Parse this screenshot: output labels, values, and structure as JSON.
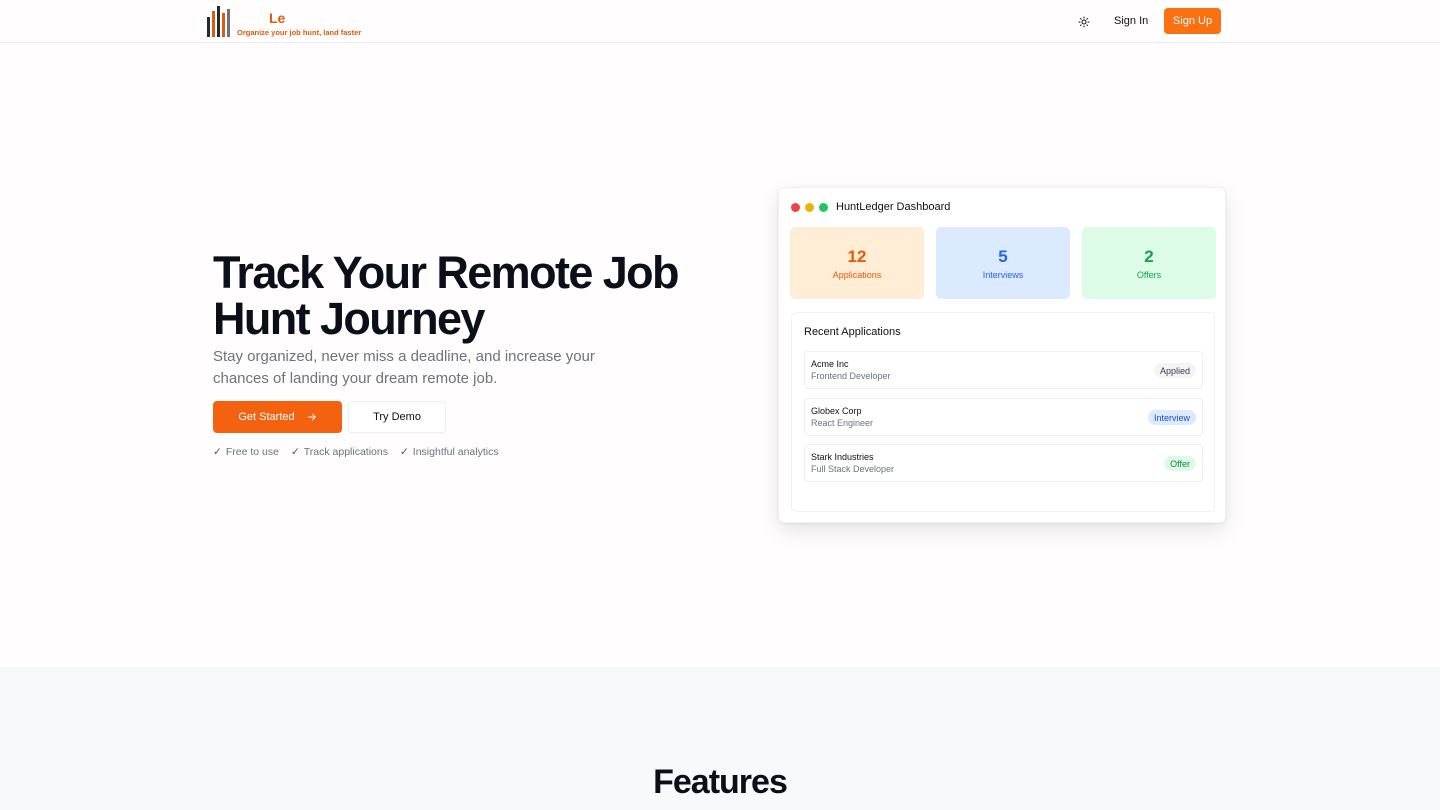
{
  "header": {
    "logo_name": "Le",
    "logo_tagline": "Organize your job hunt, land faster",
    "theme_icon": "sun-icon",
    "signin_label": "Sign In",
    "signup_label": "Sign Up"
  },
  "hero": {
    "title": "Track Your Remote Job Hunt Journey",
    "subtitle": "Stay organized, never miss a deadline, and increase your chances of landing your dream remote job.",
    "primary_cta": "Get Started",
    "primary_cta_icon": "arrow-right-icon",
    "secondary_cta": "Try Demo",
    "perks": [
      "Free to use",
      "Track applications",
      "Insightful analytics"
    ]
  },
  "dashboard": {
    "title": "HuntLedger Dashboard",
    "stats": [
      {
        "value": "12",
        "label": "Applications",
        "bg": "#ffedd5",
        "color": "#ea580c"
      },
      {
        "value": "5",
        "label": "Interviews",
        "bg": "#dbeafe",
        "color": "#2563eb"
      },
      {
        "value": "2",
        "label": "Offers",
        "bg": "#dcfce7",
        "color": "#16a34a"
      }
    ],
    "recent_title": "Recent Applications",
    "applications": [
      {
        "company": "Acme Inc",
        "role": "Frontend Developer",
        "status": "Applied",
        "badge_bg": "#f3f4f6",
        "badge_color": "#374151"
      },
      {
        "company": "Globex Corp",
        "role": "React Engineer",
        "status": "Interview",
        "badge_bg": "#dbeafe",
        "badge_color": "#1d4ed8"
      },
      {
        "company": "Stark Industries",
        "role": "Full Stack Developer",
        "status": "Offer",
        "badge_bg": "#dcfce7",
        "badge_color": "#15803d"
      }
    ]
  },
  "features": {
    "title": "Features"
  },
  "colors": {
    "accent": "#f46210",
    "window_dots": [
      "#ef4444",
      "#eab308",
      "#22c55e"
    ]
  }
}
